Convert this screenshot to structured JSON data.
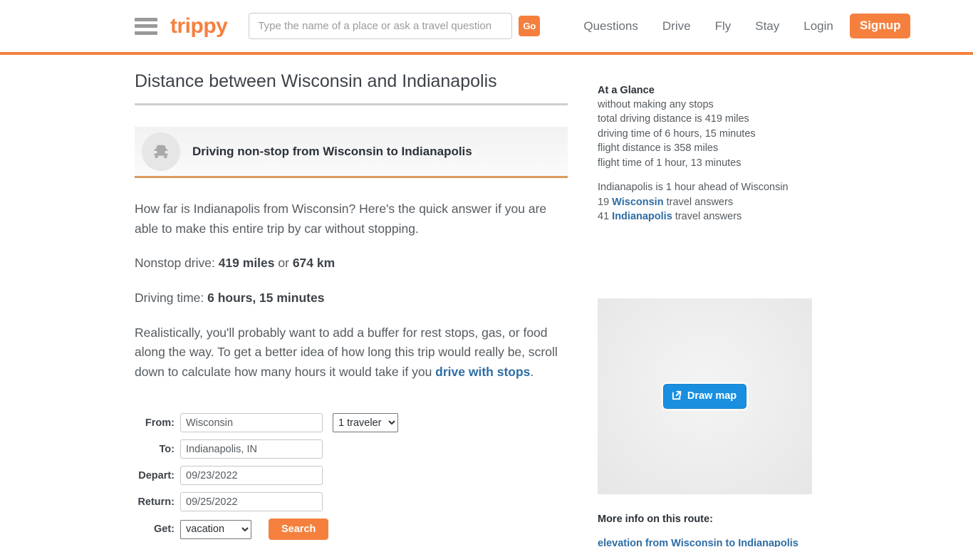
{
  "header": {
    "logo": "trippy",
    "search_placeholder": "Type the name of a place or ask a travel question",
    "search_value": "",
    "go_label": "Go",
    "nav": [
      {
        "label": "Questions"
      },
      {
        "label": "Drive"
      },
      {
        "label": "Fly"
      },
      {
        "label": "Stay"
      },
      {
        "label": "Login"
      }
    ],
    "signup_label": "Signup",
    "accent_color": "#f5803e"
  },
  "main": {
    "page_title": "Distance between Wisconsin and Indianapolis",
    "banner_title": "Driving non-stop from Wisconsin to Indianapolis",
    "intro_paragraph": "How far is Indianapolis from Wisconsin? Here's the quick answer if you are able to make this entire trip by car without stopping.",
    "nonstop_label": "Nonstop drive: ",
    "nonstop_miles": "419 miles",
    "nonstop_or": " or ",
    "nonstop_km": "674 km",
    "driving_time_label": "Driving time: ",
    "driving_time_value": "6 hours, 15 minutes",
    "buffer_paragraph": "Realistically, you'll probably want to add a buffer for rest stops, gas, or food along the way. To get a better idea of how long this trip would really be, scroll down to calculate how many hours it would take if you ",
    "buffer_link": "drive with stops",
    "buffer_paragraph_end": "."
  },
  "form": {
    "from_label": "From:",
    "from_value": "Wisconsin",
    "travelers_value": "1 traveler",
    "to_label": "To:",
    "to_value": "Indianapolis, IN",
    "depart_label": "Depart:",
    "depart_value": "09/23/2022",
    "return_label": "Return:",
    "return_value": "09/25/2022",
    "get_label": "Get:",
    "get_value": "vacation",
    "search_label": "Search"
  },
  "sidebar": {
    "glance_title": "At a Glance",
    "glance_lines": [
      "without making any stops",
      "total driving distance is 419 miles",
      "driving time of 6 hours, 15 minutes",
      "flight distance is 358 miles",
      "flight time of 1 hour, 13 minutes"
    ],
    "timezone_line": "Indianapolis is 1 hour ahead of Wisconsin",
    "answers_wisconsin_count": "19 ",
    "answers_wisconsin_link": "Wisconsin",
    "answers_wisconsin_suffix": " travel answers",
    "answers_indy_count": "41 ",
    "answers_indy_link": "Indianapolis",
    "answers_indy_suffix": " travel answers",
    "draw_map_label": "Draw map",
    "more_info_label": "More info on this route:",
    "route_link": "elevation from Wisconsin to Indianapolis",
    "link_color": "#2e6da4",
    "map_button_color": "#1a8fe0"
  }
}
